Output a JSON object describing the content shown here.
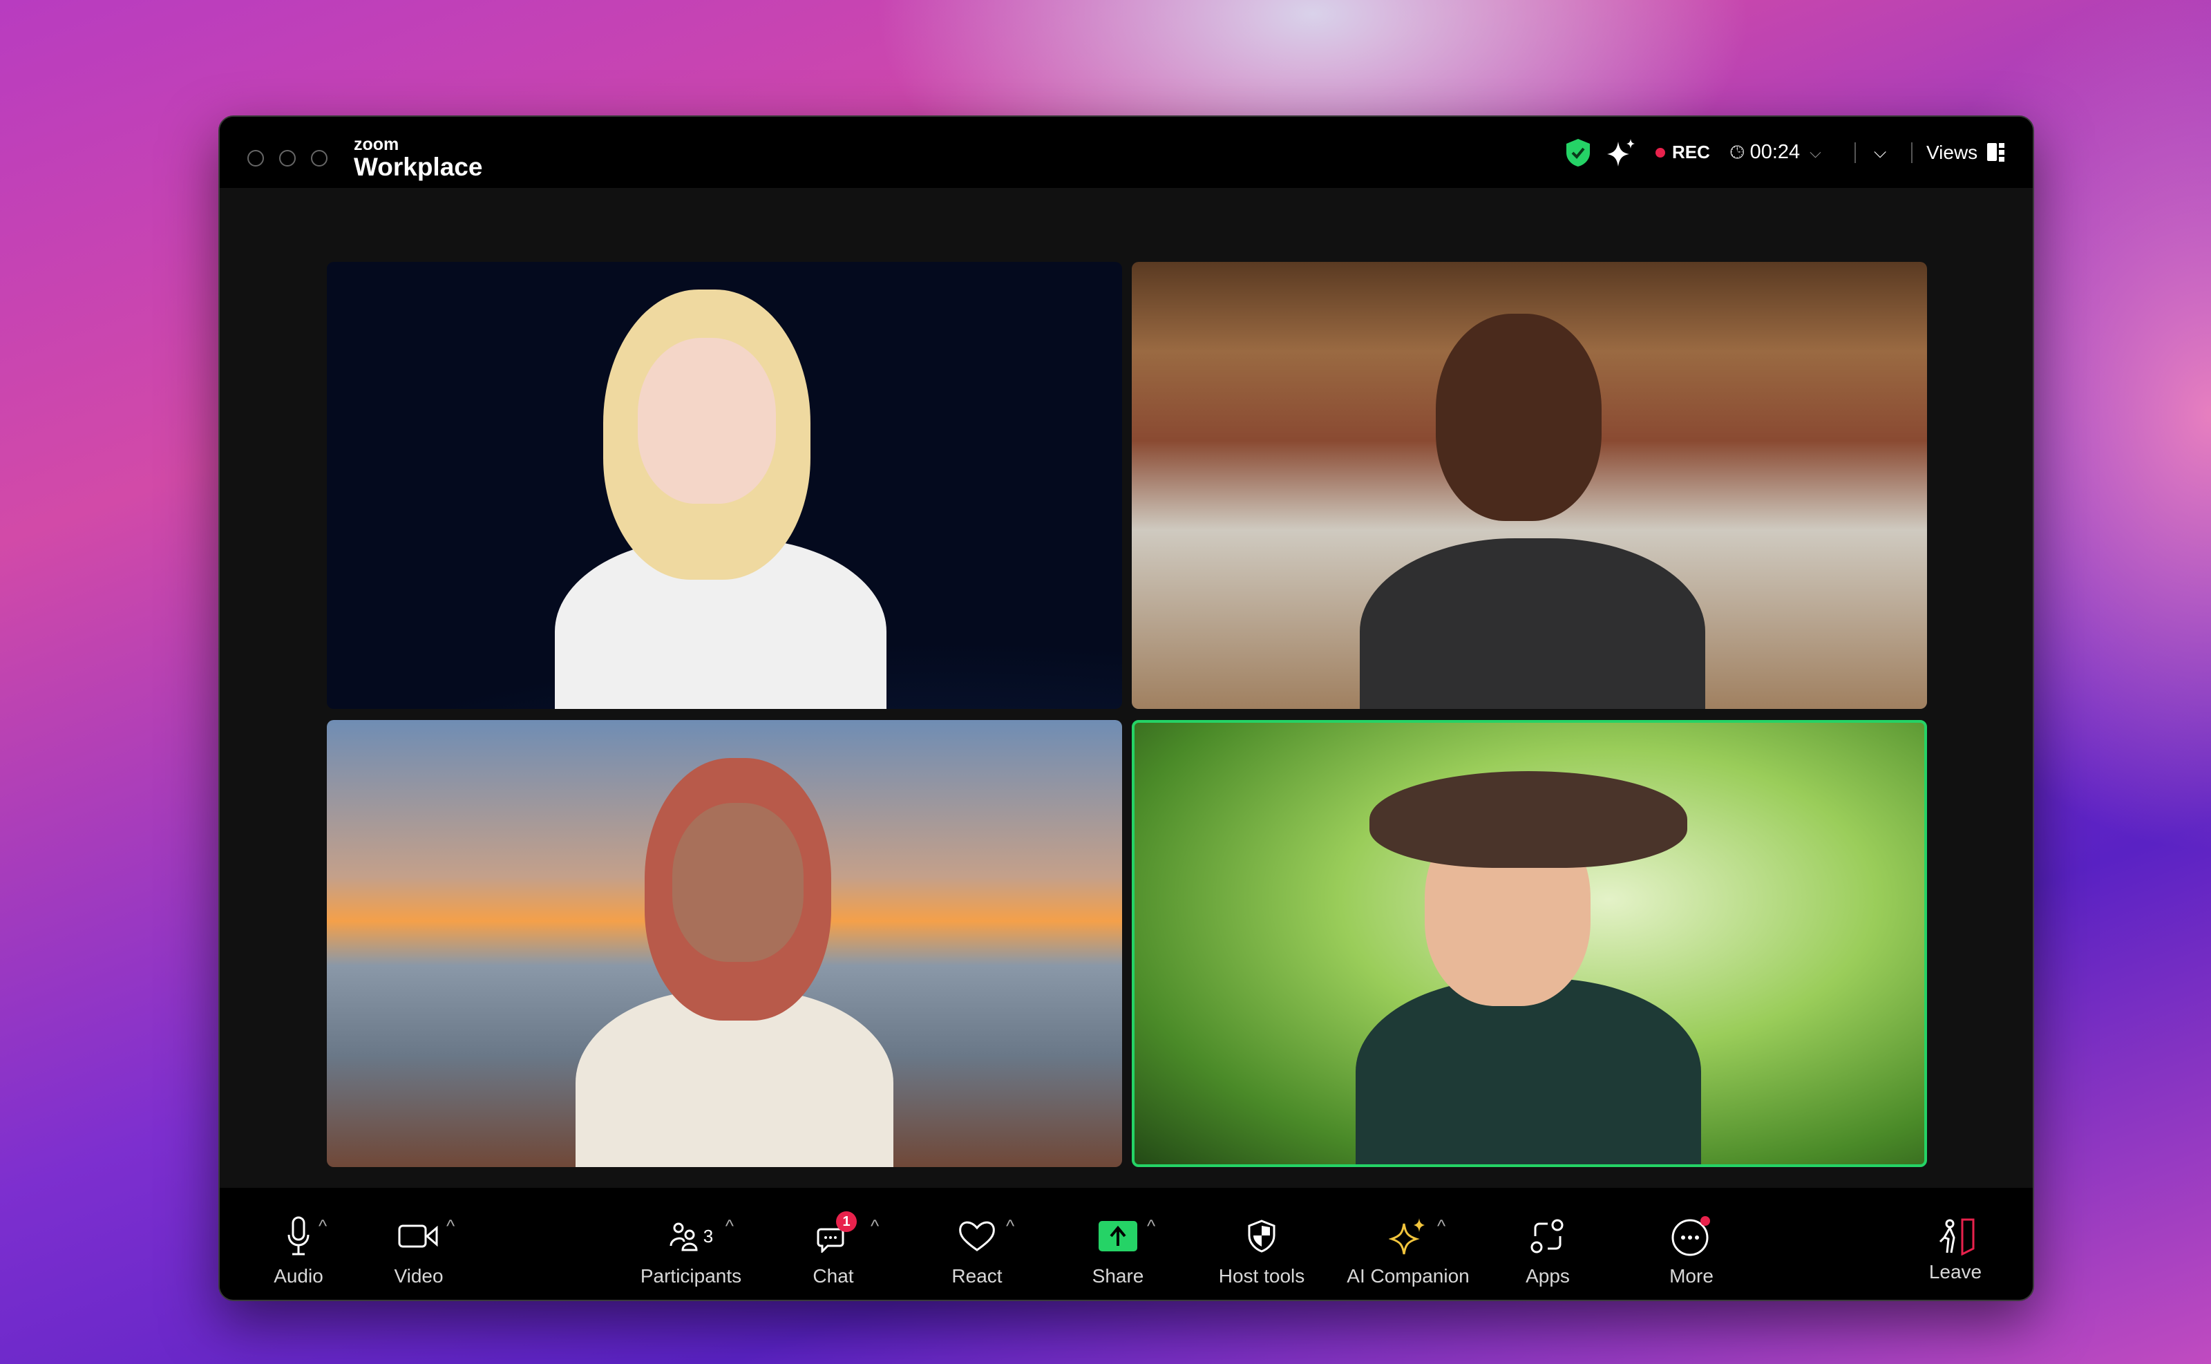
{
  "window": {
    "brand_small": "zoom",
    "brand": "Workplace"
  },
  "header": {
    "rec_label": "REC",
    "timer": "00:24",
    "views_label": "Views",
    "colors": {
      "shield": "#25d366",
      "rec_dot": "#e8224c"
    }
  },
  "toolbar": {
    "audio": "Audio",
    "video": "Video",
    "participants": "Participants",
    "participant_count": "3",
    "chat": "Chat",
    "chat_badge": "1",
    "react": "React",
    "share": "Share",
    "host_tools": "Host tools",
    "ai_companion": "AI Companion",
    "apps": "Apps",
    "more": "More",
    "leave": "Leave",
    "colors": {
      "share": "#25d366",
      "ai": "#f2c53d",
      "leave": "#e8224c"
    }
  }
}
